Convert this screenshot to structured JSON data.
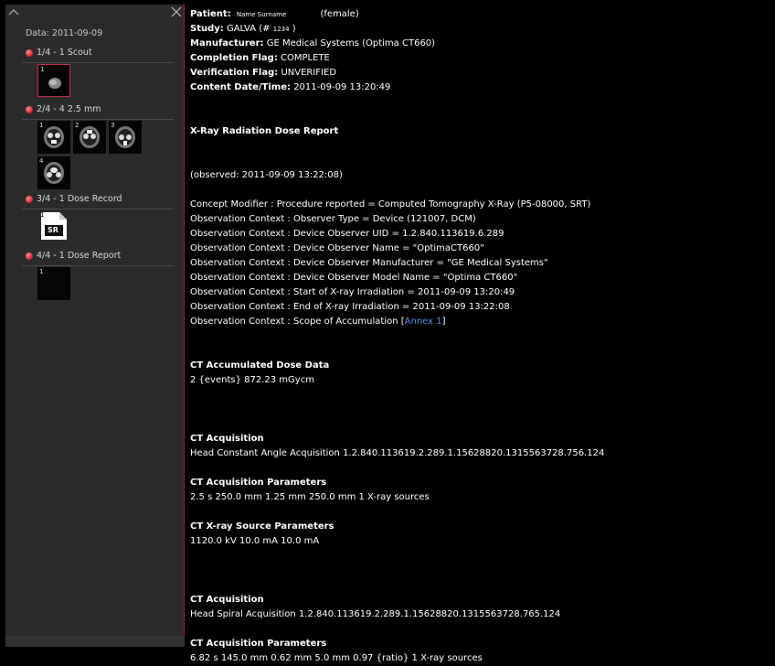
{
  "sidebar": {
    "date": "Data: 2011-09-09",
    "series": [
      {
        "label": "1/4 - 1 Scout",
        "thumbs": [
          "1"
        ]
      },
      {
        "label": "2/4 - 4 2.5 mm",
        "thumbs": [
          "1",
          "2",
          "3",
          "4"
        ]
      },
      {
        "label": "3/4 - 1 Dose Record",
        "thumbs": [
          "1"
        ],
        "sr_text": "SR"
      },
      {
        "label": "4/4 - 1 Dose Report",
        "thumbs": [
          "1"
        ]
      }
    ]
  },
  "header": {
    "patient_key": "Patient:",
    "patient_name": "Name Surname",
    "patient_sex": "(female)",
    "study_key": "Study:",
    "study_value": "GALVA (#",
    "study_id": "1234",
    "study_close": ")",
    "manufacturer_key": "Manufacturer:",
    "manufacturer_value": "GE Medical Systems (Optima CT660)",
    "completion_key": "Completion Flag:",
    "completion_value": "COMPLETE",
    "verification_key": "Verification Flag:",
    "verification_value": "UNVERIFIED",
    "content_key": "Content Date/Time:",
    "content_value": "2011-09-09 13:20:49"
  },
  "report": {
    "title": "X-Ray Radiation Dose Report",
    "observed": "(observed: 2011-09-09 13:22:08)",
    "context_lines": [
      "Concept Modifier : Procedure reported = Computed Tomography X-Ray (P5-08000, SRT)",
      "Observation Context : Observer Type = Device (121007, DCM)",
      "Observation Context : Device Observer UID = 1.2.840.113619.6.289",
      "Observation Context : Device Observer Name = \"OptimaCT660\"",
      "Observation Context : Device Observer Manufacturer = \"GE Medical Systems\"",
      "Observation Context : Device Observer Model Name = \"Optima CT660\"",
      "Observation Context : Start of X-ray Irradiation = 2011-09-09 13:20:49",
      "Observation Context : End of X-ray Irradiation = 2011-09-09 13:22:08"
    ],
    "scope_prefix": "Observation Context : Scope of Accumulation [",
    "scope_link": "Annex 1",
    "scope_suffix": "]",
    "accum_title": "CT Accumulated Dose Data",
    "accum_value": "2 {events} 872.23 mGycm",
    "acq1_title": "CT Acquisition",
    "acq1_value": "Head Constant Angle Acquisition 1.2.840.113619.2.289.1.15628820.1315563728.756.124",
    "acq1_params_title": "CT Acquisition Parameters",
    "acq1_params_value": "2.5 s 250.0 mm 1.25 mm 250.0 mm 1 X-ray sources",
    "acq1_src_title": "CT X-ray Source Parameters",
    "acq1_src_value": "1120.0 kV 10.0 mA 10.0 mA",
    "acq2_title": "CT Acquisition",
    "acq2_value": "Head Spiral Acquisition 1.2.840.113619.2.289.1.15628820.1315563728.765.124",
    "acq2_params_title": "CT Acquisition Parameters",
    "acq2_params_value": "6.82 s 145.0 mm 0.62 mm 5.0 mm 0.97 {ratio} 1 X-ray sources"
  },
  "colors": {
    "accent": "#a0183a",
    "link": "#4a8fe0",
    "sidebar_bg": "#2b2b2b"
  }
}
